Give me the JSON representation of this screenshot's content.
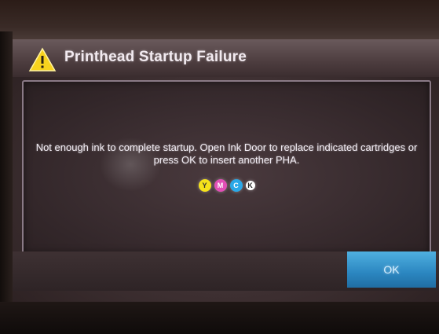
{
  "dialog": {
    "title": "Printhead Startup Failure",
    "icon": "warning-icon",
    "message": "Not enough ink to complete startup. Open Ink Door to  replace indicated cartridges or press OK to insert another PHA.",
    "cartridges": [
      {
        "label": "Y",
        "color": "#f5e21a"
      },
      {
        "label": "M",
        "color": "#e24fb6"
      },
      {
        "label": "C",
        "color": "#2aa8e8"
      },
      {
        "label": "K",
        "color": "#ffffff"
      }
    ],
    "ok_label": "OK"
  },
  "colors": {
    "ok_button": "#2b86c0",
    "warning": "#f7d21e",
    "panel_border": "#8a7a86"
  }
}
